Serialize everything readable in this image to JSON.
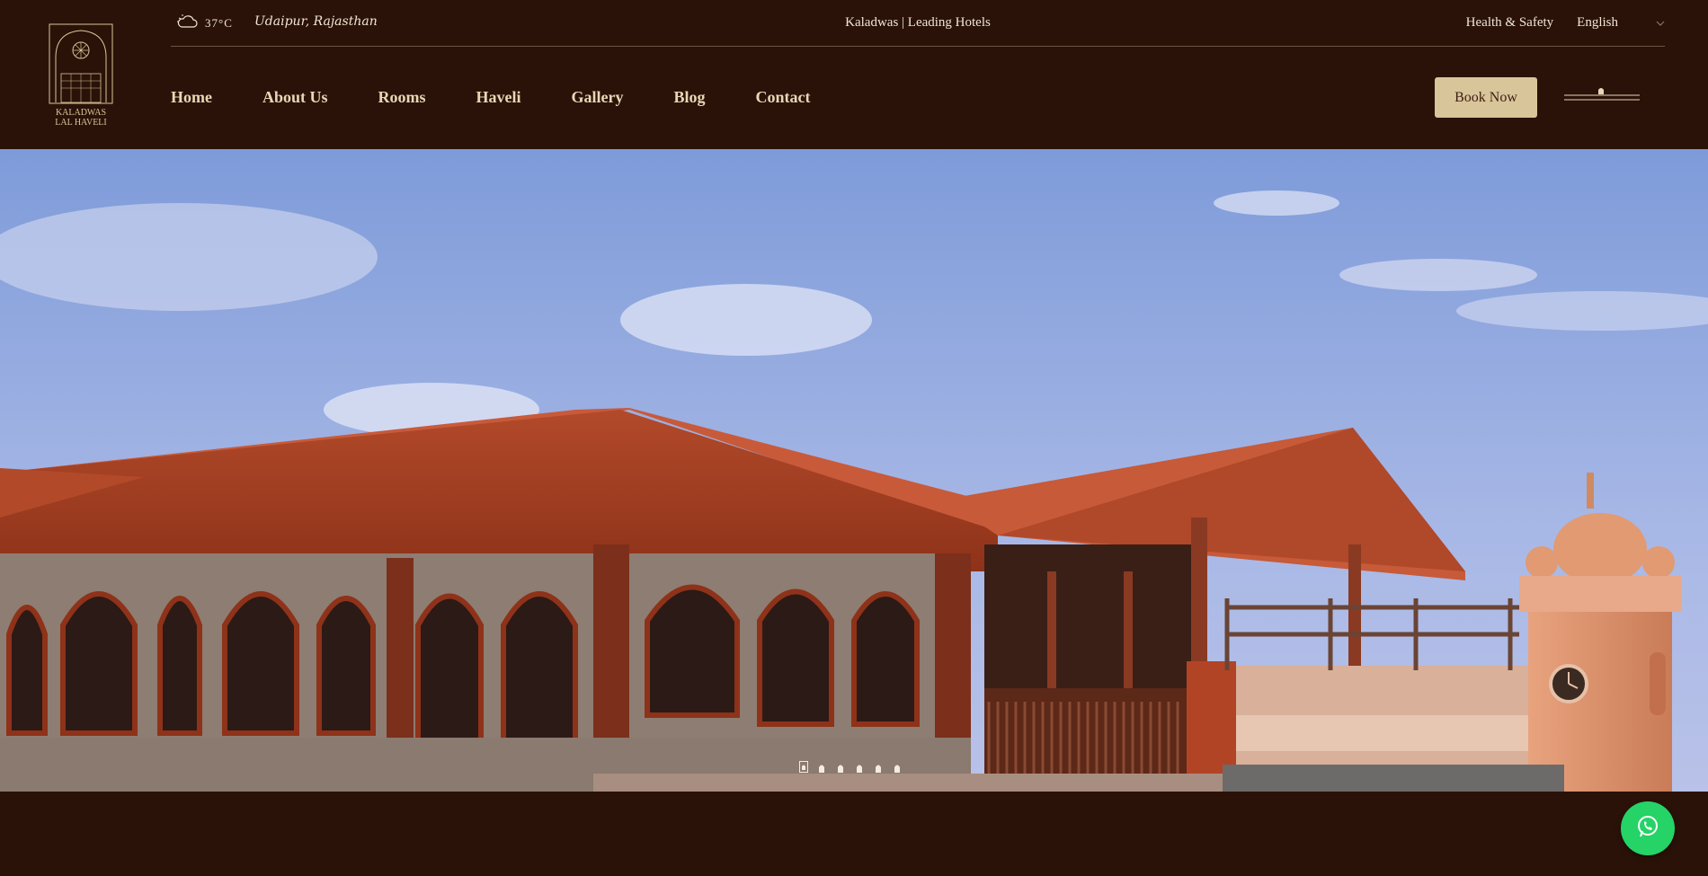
{
  "brand": {
    "logo_line1": "KALADWAS",
    "logo_line2": "LAL HAVELI"
  },
  "topbar": {
    "temperature": "37°C",
    "location": "Udaipur, Rajasthan",
    "tagline": "Kaladwas | Leading Hotels",
    "health_link": "Health & Safety",
    "language": "English"
  },
  "nav": {
    "items": [
      {
        "label": "Home"
      },
      {
        "label": "About Us"
      },
      {
        "label": "Rooms"
      },
      {
        "label": "Haveli"
      },
      {
        "label": "Gallery"
      },
      {
        "label": "Blog"
      },
      {
        "label": "Contact"
      }
    ],
    "book_label": "Book Now"
  },
  "slider": {
    "slide_count": 6,
    "active_index": 0
  },
  "colors": {
    "background": "#2a1208",
    "nav_text": "#e8d7b6",
    "button_bg": "#d9c59a",
    "whatsapp": "#25d366"
  },
  "icons": [
    "weather-cloud-sun-icon",
    "chevron-down-icon",
    "menu-icon",
    "whatsapp-icon",
    "slider-dot-icon"
  ]
}
